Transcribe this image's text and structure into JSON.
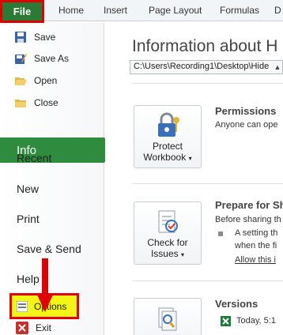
{
  "ribbon": {
    "file_label": "File",
    "tabs": [
      "Home",
      "Insert",
      "Page Layout",
      "Formulas",
      "D"
    ]
  },
  "left_pane": {
    "commands": [
      "Save",
      "Save As",
      "Open",
      "Close"
    ],
    "nav": {
      "info": "Info",
      "recent": "Recent",
      "new": "New",
      "print": "Print",
      "save_send": "Save & Send",
      "help": "Help",
      "options": "Options",
      "exit": "Exit"
    }
  },
  "main": {
    "heading": "Information about H",
    "path": "C:\\Users\\Recording1\\Desktop\\Hide",
    "permissions": {
      "button_line1": "Protect",
      "button_line2": "Workbook",
      "title": "Permissions",
      "text": "Anyone can ope"
    },
    "prepare": {
      "button_line1": "Check for",
      "button_line2": "Issues",
      "title": "Prepare for Sh",
      "text": "Before sharing th",
      "bullet_line1": "A setting th",
      "bullet_line2": "when the fi",
      "link": "Allow this i"
    },
    "versions": {
      "title": "Versions",
      "item": "Today, 5:1"
    }
  },
  "colors": {
    "file_tab": "#2c7a36",
    "info_highlight": "#2f8b3e",
    "annotation_red": "#e00000",
    "annotation_yellow": "#f4f416"
  }
}
